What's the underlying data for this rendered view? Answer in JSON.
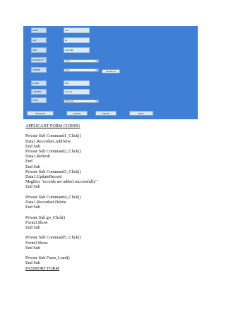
{
  "form": {
    "labels": [
      "NAME",
      "AGE",
      "DOB",
      "NATIONALITY",
      "GENDER",
      "PHONE",
      "ADDRESS",
      "STATE"
    ],
    "values": [
      "ravi",
      "18",
      "1/1/1996",
      "indian",
      "male",
      "998",
      "chennai",
      "tamilnadu"
    ],
    "data_control": "Data1",
    "buttons": [
      "REGISTER",
      "CANCEL",
      "DELETE",
      "NEXT"
    ]
  },
  "code": {
    "heading": "APPLICANT FORM CODING",
    "lines": [
      "Private Sub Command1_Click()",
      "Data1.Recordset.AddNew",
      "End Sub",
      "Private Sub Command2_Click()",
      "Data1.Refresh",
      "End",
      "End Sub",
      "Private Sub Command3_Click()",
      "Data1.UpdateRecord",
      "MsgBox \"records are added successfully\"",
      "End Sub",
      "",
      "Private Sub Command4_Click()",
      "Data1.Recordset.Delete",
      "End Sub",
      "",
      "Private Sub go_Click()",
      "Form3.Show",
      "End Sub",
      "",
      "Private Sub Command5_Click()",
      "Form3.Show",
      "End Sub",
      "",
      "Private Sub Form_Load()",
      "End Sub"
    ],
    "footer": "PASSPORT FORM"
  }
}
